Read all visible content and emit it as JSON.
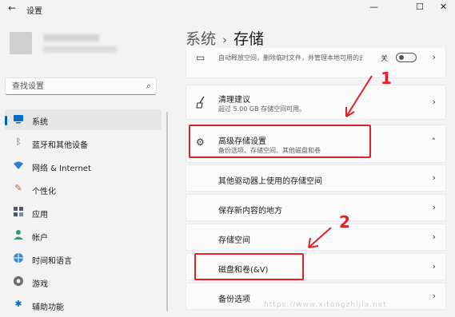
{
  "window": {
    "title": "设置"
  },
  "sidebar": {
    "search_placeholder": "查找设置",
    "items": [
      {
        "label": "系统",
        "icon": "monitor-icon",
        "active": true
      },
      {
        "label": "蓝牙和其他设备",
        "icon": "bluetooth-icon"
      },
      {
        "label": "网络 & Internet",
        "icon": "wifi-icon"
      },
      {
        "label": "个性化",
        "icon": "brush-icon"
      },
      {
        "label": "应用",
        "icon": "apps-icon"
      },
      {
        "label": "帐户",
        "icon": "person-icon"
      },
      {
        "label": "时间和语言",
        "icon": "globe-icon"
      },
      {
        "label": "游戏",
        "icon": "gamepad-icon"
      },
      {
        "label": "辅助功能",
        "icon": "accessibility-icon"
      }
    ]
  },
  "breadcrumb": {
    "parent": "系统",
    "separator": "›",
    "current": "存储"
  },
  "cards": {
    "top_partial": {
      "subtitle": "自动释放空间，删除临时文件，并管理本地可用的云内容",
      "toggle_label": "关"
    },
    "cleanup": {
      "title": "清理建议",
      "subtitle": "超过 5.00 GB 存储空间可用。"
    },
    "advanced": {
      "title": "高级存储设置",
      "subtitle": "备份选项、存储空间、其他磁盘和卷"
    }
  },
  "advanced_items": [
    "其他驱动器上使用的存储空间",
    "保存新内容的地方",
    "存储空间",
    "磁盘和卷(&V)",
    "备份选项"
  ],
  "annotations": {
    "step1": "1",
    "step2": "2",
    "color": "#e0202a"
  },
  "watermark": "https://www.xitongzhijia.net",
  "colors": {
    "accent": "#005fb8",
    "annotation_red": "#e0202a"
  }
}
